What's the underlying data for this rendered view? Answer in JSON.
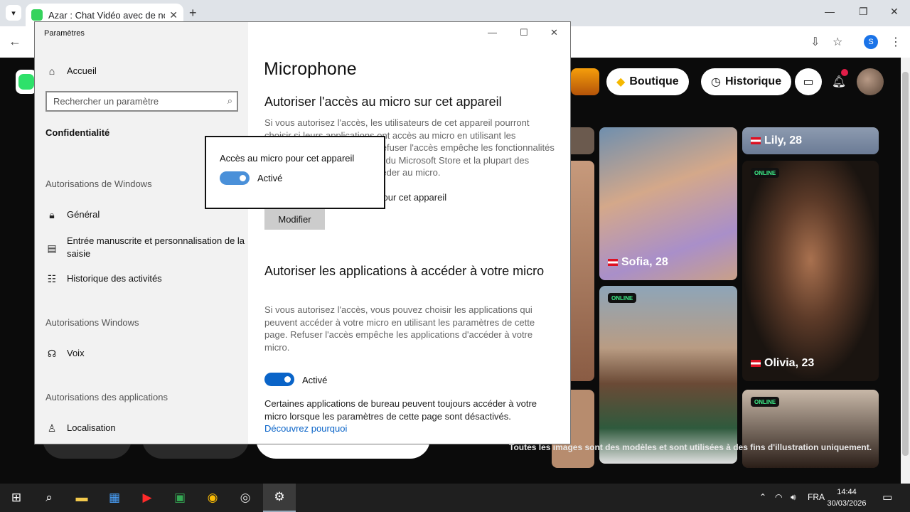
{
  "browser": {
    "tab_title": "Azar : Chat Vidéo avec de nouv",
    "tab_close": "✕",
    "new_tab": "+",
    "profile_initial": "S"
  },
  "azar": {
    "shop_label": "Boutique",
    "history_label": "Historique",
    "cards": [
      {
        "name": "Lily, 28",
        "online": false
      },
      {
        "name": "Sofia, 28",
        "online": false
      },
      {
        "name": "Olivia, 23",
        "online": true
      },
      {
        "name": "",
        "online": true
      },
      {
        "name": "",
        "online": true
      }
    ],
    "online_label": "ONLINE",
    "disclaimer": "Toutes les images sont des modèles et sont utilisées à des fins d'illustration uniquement."
  },
  "settings": {
    "window_title": "Paramètres",
    "home": "Accueil",
    "search_placeholder": "Rechercher un paramètre",
    "active_section": "Confidentialité",
    "windows_permissions_header": "Autorisations de Windows",
    "nav_general": "Général",
    "nav_handwriting": "Entrée manuscrite et personnalisation de la saisie",
    "nav_activity": "Historique des activités",
    "windows_header": "Autorisations Windows",
    "nav_voice": "Voix",
    "app_permissions_header": "Autorisations des applications",
    "nav_location": "Localisation",
    "page_title": "Microphone",
    "device_heading": "Autoriser l'accès au micro sur cet appareil",
    "device_para": "Si vous autorisez l'accès, les utilisateurs de cet appareil pourront choisir si leurs applications ont accès au micro en utilisant les paramètres de cette page. Refuser l'accès empêche les fonctionnalités de Windows, les applications du Microsoft Store et la plupart des applications de bureau d'accéder au micro.",
    "device_status": "L'accès au micro est activé pour cet appareil",
    "modify_button": "Modifier",
    "apps_heading": "Autoriser les applications à accéder à votre micro",
    "apps_para": "Si vous autorisez l'accès, vous pouvez choisir les applications qui peuvent accéder à votre micro en utilisant les paramètres de cette page. Refuser l'accès empêche les applications d'accéder à votre micro.",
    "apps_toggle_label": "Activé",
    "desktop_note": "Certaines applications de bureau peuvent toujours accéder à votre micro lorsque les paramètres de cette page sont désactivés.",
    "learn_why": "Découvrez pourquoi"
  },
  "popup": {
    "title": "Accès au micro pour cet appareil",
    "toggle_label": "Activé"
  },
  "taskbar": {
    "language": "FRA",
    "time": "14:44",
    "date": "30/03/2026"
  }
}
